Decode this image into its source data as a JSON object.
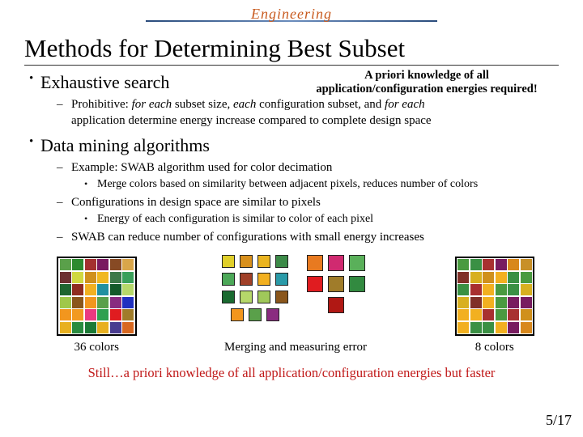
{
  "logo": "Engineering",
  "title": "Methods for Determining Best Subset",
  "bullet1": "Exhaustive search",
  "note_line1": "A priori knowledge of all",
  "note_line2": "application/configuration energies required!",
  "b1_sub_1a": "Prohibitive: ",
  "b1_sub_1b": "for each",
  "b1_sub_1c": " subset size, ",
  "b1_sub_1d": "each",
  "b1_sub_1e": " configuration subset, and ",
  "b1_sub_1f": "for each",
  "b1_sub_1g": "application determine energy increase compared to complete design space",
  "bullet2": "Data mining algorithms",
  "b2_sub_1": "Example: SWAB algorithm used for color decimation",
  "b2_sub_1_a": "Merge colors based on similarity between adjacent pixels, reduces number of colors",
  "b2_sub_2": "Configurations in design space are similar to pixels",
  "b2_sub_2_a": "Energy of each configuration is similar to color of each pixel",
  "b2_sub_3": "SWAB can reduce number of configurations with small energy increases",
  "cap_left": "36 colors",
  "cap_mid": "Merging and measuring error",
  "cap_right": "8 colors",
  "conclusion": "Still…a priori knowledge of all application/configuration energies but faster",
  "page": "5/17",
  "grid36": [
    "#5aa04a",
    "#2d8a2f",
    "#a43030",
    "#7a1a60",
    "#874a24",
    "#d9a64a",
    "#6c3030",
    "#d0d840",
    "#d0901c",
    "#f0b820",
    "#3c7848",
    "#3aa05a",
    "#1f6530",
    "#8f2c20",
    "#f2b020",
    "#2290a0",
    "#145a2a",
    "#b6d86a",
    "#a0c84a",
    "#8a561c",
    "#f2961e",
    "#5aa04a",
    "#882c80",
    "#2030c0",
    "#f2961e",
    "#f29a20",
    "#ea3a80",
    "#2ea050",
    "#e01c20",
    "#a07c2a",
    "#e8b020",
    "#2a8c40",
    "#1c7a36",
    "#e8b020",
    "#4a3c90",
    "#d86820"
  ],
  "midA": [
    "#e0cf2a",
    "#d8901c",
    "#eab420",
    "#3c8a48",
    "#4ca858",
    "#a04028",
    "#f2b020",
    "#2a9aa8",
    "#1a6a30",
    "#b6d86a",
    "#a0c85a",
    "#8a561c",
    "#f2961e",
    "#5aa04a",
    "#8a2c80"
  ],
  "midB": [
    "#e87a20",
    "#d02a70",
    "#5ab05a",
    "#e01c20",
    "#a07c2a",
    "#328a40",
    "#b01814"
  ],
  "grid8": [
    "#4a9a40",
    "#3a9044",
    "#a83030",
    "#781c60",
    "#d8881c",
    "#c89028",
    "#803028",
    "#d8b020",
    "#d0901c",
    "#f2b020",
    "#3a9044",
    "#4a9a40",
    "#3a9044",
    "#a83030",
    "#f2b020",
    "#4a9a40",
    "#3a9044",
    "#d8b020",
    "#d8b020",
    "#803028",
    "#f2b020",
    "#4a9a40",
    "#781c60",
    "#781c60",
    "#f2b020",
    "#f2b020",
    "#a83030",
    "#4a9a40",
    "#a83030",
    "#d0901c",
    "#f2b020",
    "#3a9044",
    "#3a9044",
    "#f2b020",
    "#781c60",
    "#d8881c"
  ]
}
